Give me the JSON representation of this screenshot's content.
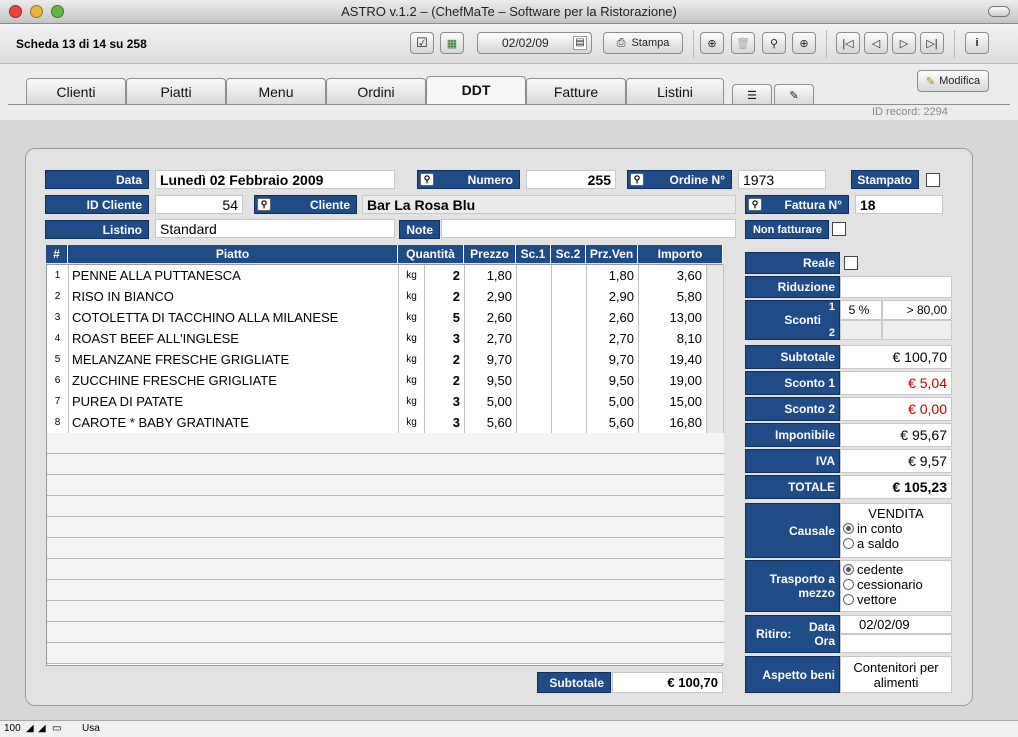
{
  "window": {
    "title": "ASTRO  v.1.2 – (ChefMaTe – Software per la Ristorazione)"
  },
  "toolbar": {
    "record_info": "Scheda 13 di 14 su 258",
    "date": "02/02/09",
    "print_label": "Stampa"
  },
  "tabs": [
    "Clienti",
    "Piatti",
    "Menu",
    "Ordini",
    "DDT",
    "Fatture",
    "Listini"
  ],
  "active_tab": "DDT",
  "modify_label": "Modifica",
  "id_record": "ID record: 2294",
  "form": {
    "data_label": "Data",
    "data_value": "Lunedì 02 Febbraio 2009",
    "numero_label": "Numero",
    "numero_value": "255",
    "ordine_label": "Ordine N°",
    "ordine_value": "1973",
    "stampato_label": "Stampato",
    "id_cliente_label": "ID Cliente",
    "id_cliente_value": "54",
    "cliente_label": "Cliente",
    "cliente_value": "Bar La Rosa Blu",
    "fattura_label": "Fattura N°",
    "fattura_value": "18",
    "listino_label": "Listino",
    "listino_value": "Standard",
    "note_label": "Note",
    "note_value": "",
    "non_fatturare_label": "Non fatturare"
  },
  "table": {
    "headers": [
      "#",
      "Piatto",
      "Quantità",
      "Prezzo",
      "Sc.1",
      "Sc.2",
      "Prz.Ven",
      "Importo"
    ],
    "rows": [
      {
        "n": "1",
        "piatto": "PENNE ALLA PUTTANESCA",
        "um": "kg",
        "qta": "2",
        "prezzo": "1,80",
        "sc1": "",
        "sc2": "",
        "przven": "1,80",
        "importo": "3,60"
      },
      {
        "n": "2",
        "piatto": "RISO IN BIANCO",
        "um": "kg",
        "qta": "2",
        "prezzo": "2,90",
        "sc1": "",
        "sc2": "",
        "przven": "2,90",
        "importo": "5,80"
      },
      {
        "n": "3",
        "piatto": "COTOLETTA DI  TACCHINO ALLA  MILANESE",
        "um": "kg",
        "qta": "5",
        "prezzo": "2,60",
        "sc1": "",
        "sc2": "",
        "przven": "2,60",
        "importo": "13,00"
      },
      {
        "n": "4",
        "piatto": "ROAST BEEF ALL'INGLESE",
        "um": "kg",
        "qta": "3",
        "prezzo": "2,70",
        "sc1": "",
        "sc2": "",
        "przven": "2,70",
        "importo": "8,10"
      },
      {
        "n": "5",
        "piatto": "MELANZANE FRESCHE GRIGLIATE",
        "um": "kg",
        "qta": "2",
        "prezzo": "9,70",
        "sc1": "",
        "sc2": "",
        "przven": "9,70",
        "importo": "19,40"
      },
      {
        "n": "6",
        "piatto": "ZUCCHINE FRESCHE GRIGLIATE",
        "um": "kg",
        "qta": "2",
        "prezzo": "9,50",
        "sc1": "",
        "sc2": "",
        "przven": "9,50",
        "importo": "19,00"
      },
      {
        "n": "7",
        "piatto": "PUREA DI PATATE",
        "um": "kg",
        "qta": "3",
        "prezzo": "5,00",
        "sc1": "",
        "sc2": "",
        "przven": "5,00",
        "importo": "15,00"
      },
      {
        "n": "8",
        "piatto": "CAROTE * BABY GRATINATE",
        "um": "kg",
        "qta": "3",
        "prezzo": "5,60",
        "sc1": "",
        "sc2": "",
        "przven": "5,60",
        "importo": "16,80"
      }
    ],
    "subtotal_label": "Subtotale",
    "subtotal_value": "€ 100,70"
  },
  "side": {
    "reale_label": "Reale",
    "riduzione_label": "Riduzione",
    "sconti_label": "Sconti",
    "sconti_1": "1",
    "sconti_2": "2",
    "sconto_pct": "5 %",
    "sconto_soglia": "> 80,00",
    "subtotale_label": "Subtotale",
    "subtotale_value": "€ 100,70",
    "sconto1_label": "Sconto 1",
    "sconto1_value": "€ 5,04",
    "sconto2_label": "Sconto 2",
    "sconto2_value": "€ 0,00",
    "imponibile_label": "Imponibile",
    "imponibile_value": "€ 95,67",
    "iva_label": "IVA",
    "iva_value": "€ 9,57",
    "totale_label": "TOTALE",
    "totale_value": "€ 105,23",
    "causale_label": "Causale",
    "causale_value": "VENDITA",
    "causale_opt1": "in conto",
    "causale_opt2": "a saldo",
    "trasporto_label": "Trasporto a mezzo",
    "trasporto_opt1": "cedente",
    "trasporto_opt2": "cessionario",
    "trasporto_opt3": "vettore",
    "ritiro_label": "Ritiro:",
    "ritiro_data_label": "Data",
    "ritiro_ora_label": "Ora",
    "ritiro_data_value": "02/02/09",
    "ritiro_ora_value": "",
    "aspetto_label": "Aspetto beni",
    "aspetto_value": "Contenitori per alimenti"
  },
  "status": {
    "zoom": "100",
    "mode": "Usa"
  },
  "colors": {
    "label_bg": "#1f4c87",
    "discount_text": "#c00000"
  }
}
